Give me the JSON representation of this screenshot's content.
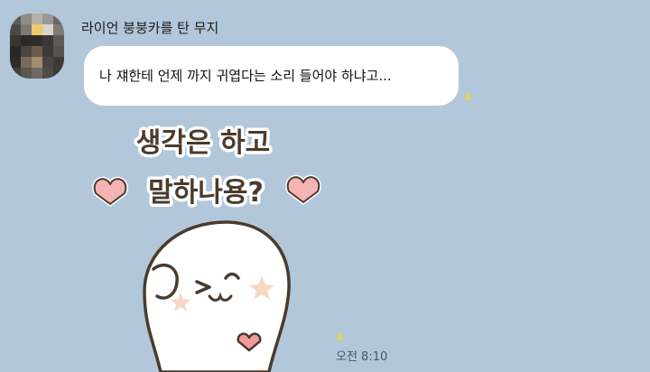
{
  "chat": {
    "sender_name": "라이언 붕붕카를 탄 무지",
    "message_text": "나 쟤한테 언제 까지 귀엽다는 소리 들어야 하냐고...",
    "message_unread": "4",
    "sticker_line1": "생각은 하고",
    "sticker_line2": "말하나용?",
    "sticker_unread": "4",
    "timestamp": "오전 8:10"
  },
  "colors": {
    "background": "#b2c7da",
    "bubble": "#ffffff",
    "unread_count": "#f3d431",
    "heart": "#f6b3b3",
    "sticker_outline": "#4a3b2d"
  },
  "icons": {
    "avatar": "pixelated-profile-photo",
    "sticker": "smiling-blob-character-sticker"
  }
}
